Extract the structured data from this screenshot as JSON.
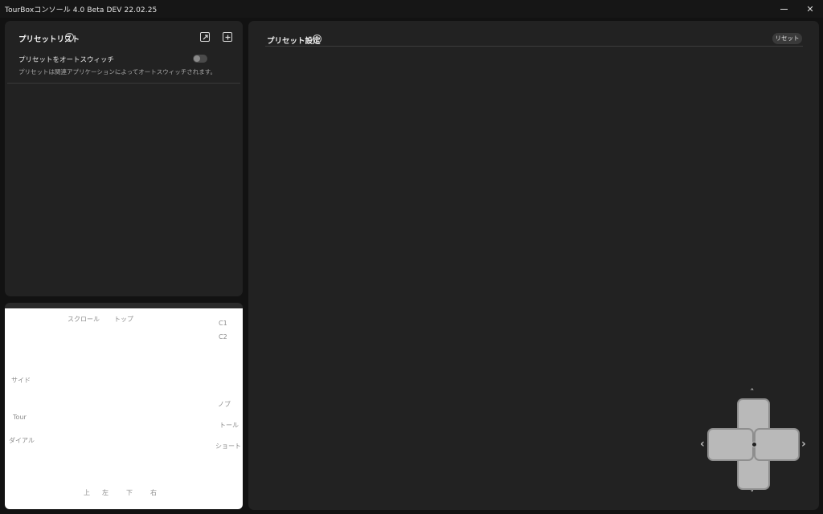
{
  "app": {
    "title": "TourBoxコンソール 4.0 Beta DEV 22.02.25"
  },
  "window_controls": {
    "close_label": "✕"
  },
  "preset_list": {
    "title": "プリセットリスト",
    "help_glyph": "?",
    "auto_switch_label": "プリセットをオートスウィッチ",
    "auto_switch_desc": "プリセットは関連アプリケーションによってオートスウィッチされます。",
    "auto_switch_on": false
  },
  "preset_settings": {
    "title": "プリセット設定",
    "help_glyph": "?",
    "reset_label": "リセット"
  },
  "device_labels": {
    "scroll": "スクロール",
    "top": "トップ",
    "c1": "C1",
    "c2": "C2",
    "side": "サイド",
    "knob": "ノブ",
    "tour": "Tour",
    "tall": "トール",
    "dial": "ダイアル",
    "short": "ショート",
    "up": "上",
    "left": "左",
    "down": "下",
    "right": "右"
  },
  "dpad": {
    "up_arrow": "˄",
    "down_arrow": "˅",
    "left_arrow": "‹",
    "right_arrow": "›"
  },
  "colors": {
    "background": "#121212",
    "panel": "#222222",
    "device_canvas": "#ffffff",
    "dpad_key": "#b9b9b9"
  }
}
